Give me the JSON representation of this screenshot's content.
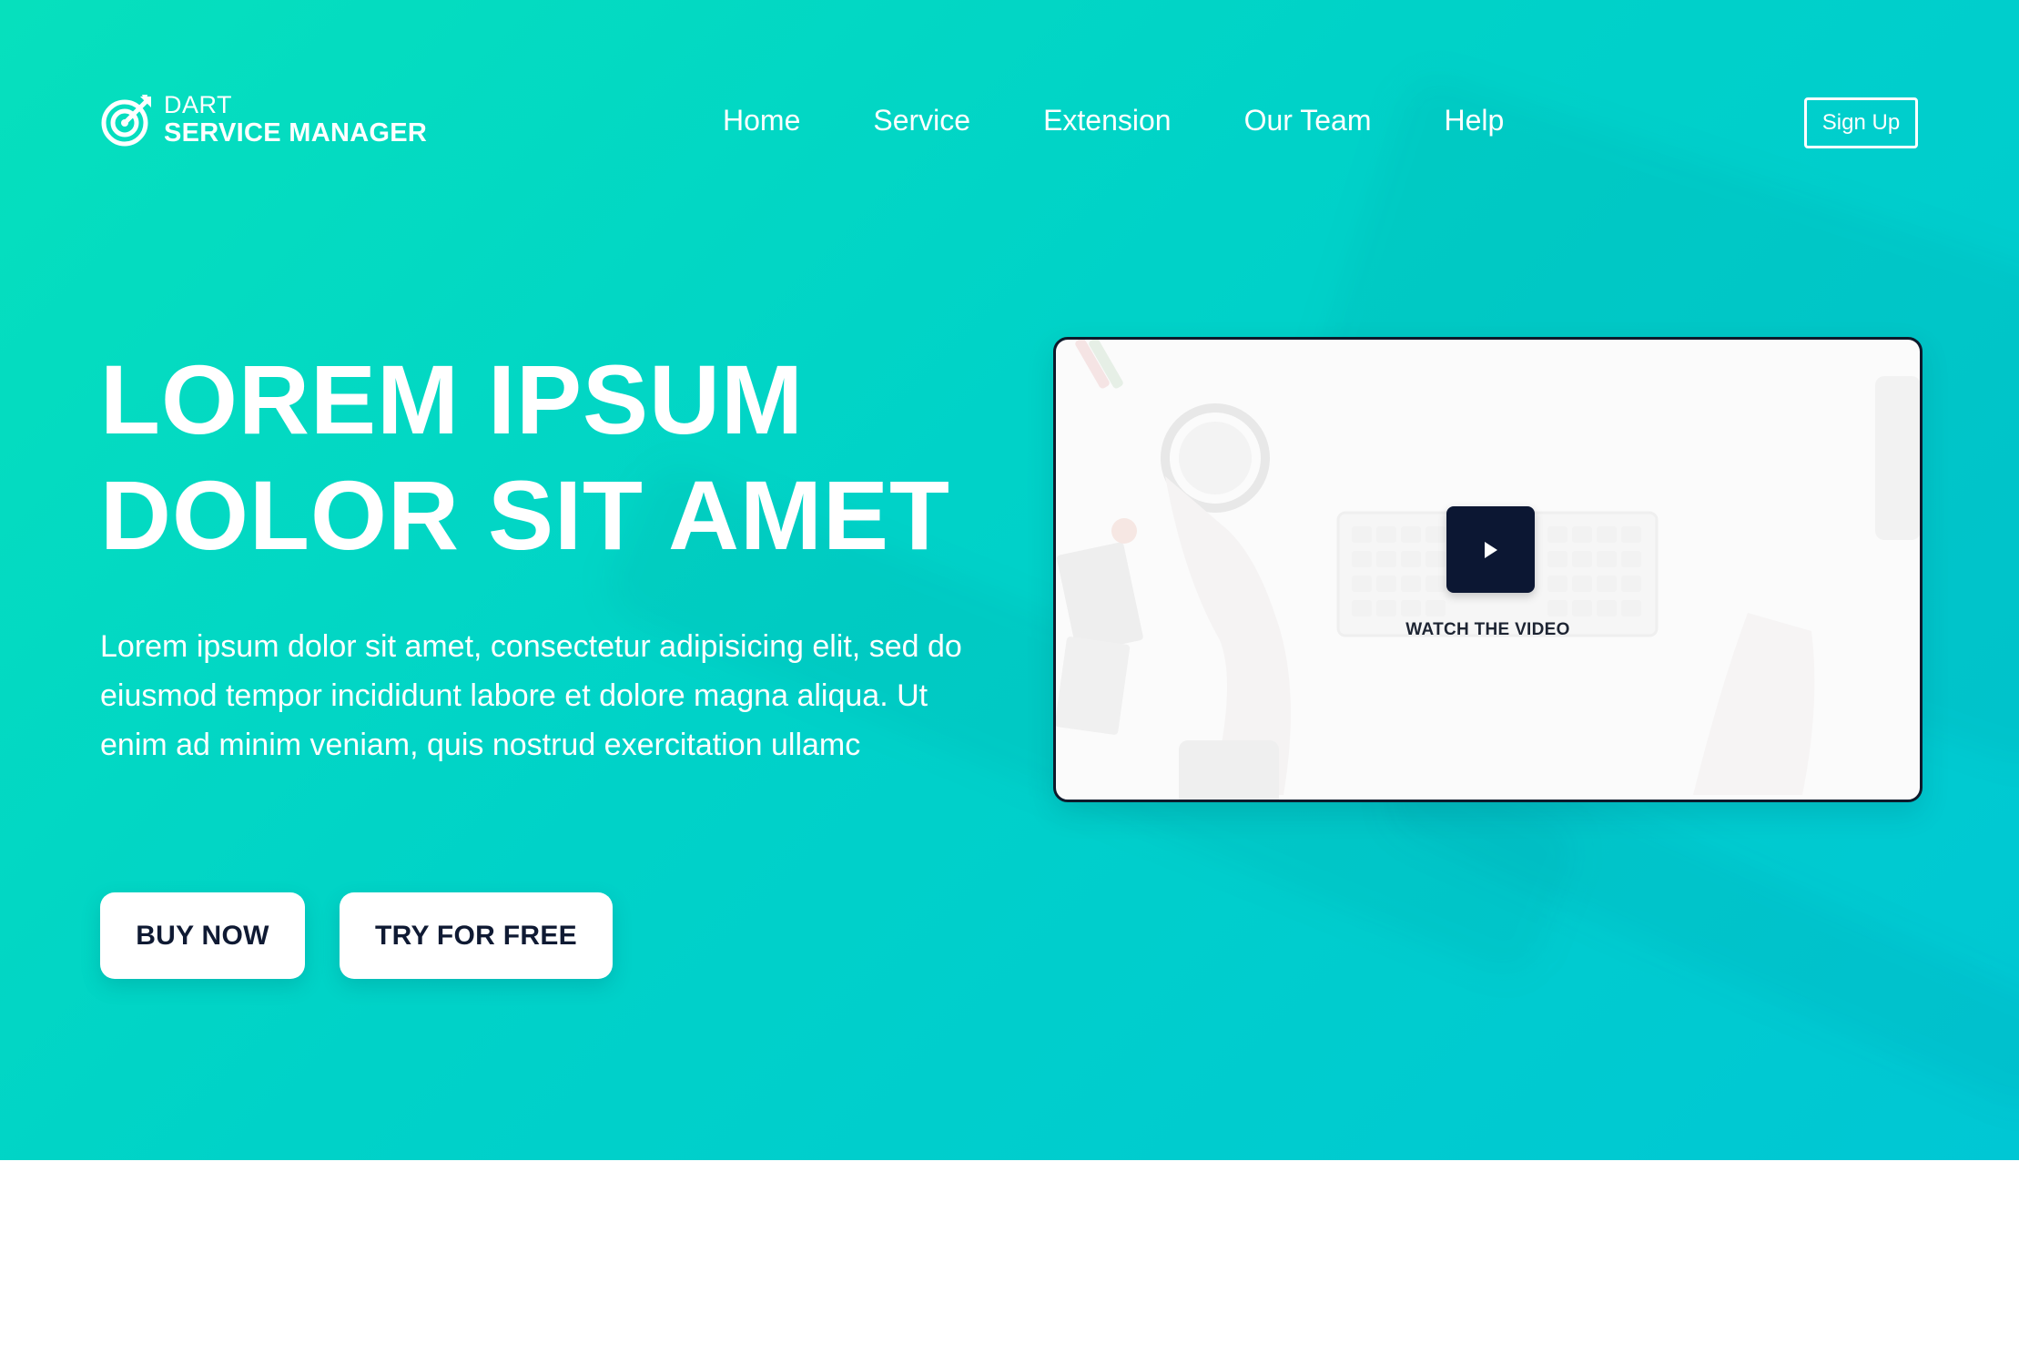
{
  "brand": {
    "line1": "DART",
    "line2": "SERVICE MANAGER",
    "icon": "target-arrow-icon"
  },
  "nav": {
    "items": [
      "Home",
      "Service",
      "Extension",
      "Our Team",
      "Help"
    ]
  },
  "header": {
    "signup_label": "Sign Up"
  },
  "hero": {
    "headline_line1": "LOREM IPSUM",
    "headline_line2": "DOLOR SIT AMET",
    "lead": "Lorem ipsum dolor sit amet, consectetur adipisicing elit, sed do eiusmod tempor incididunt labore et dolore magna aliqua. Ut enim ad minim veniam, quis nostrud exercitation ullamc",
    "buy_label": "BUY NOW",
    "try_label": "TRY FOR FREE"
  },
  "video": {
    "play_icon": "play-icon",
    "watch_label": "WATCH THE VIDEO"
  },
  "colors": {
    "gradient_start": "#06e0bd",
    "gradient_end": "#00c7d4",
    "dark_navy": "#0c1733",
    "text_on_hero": "#ffffff"
  }
}
